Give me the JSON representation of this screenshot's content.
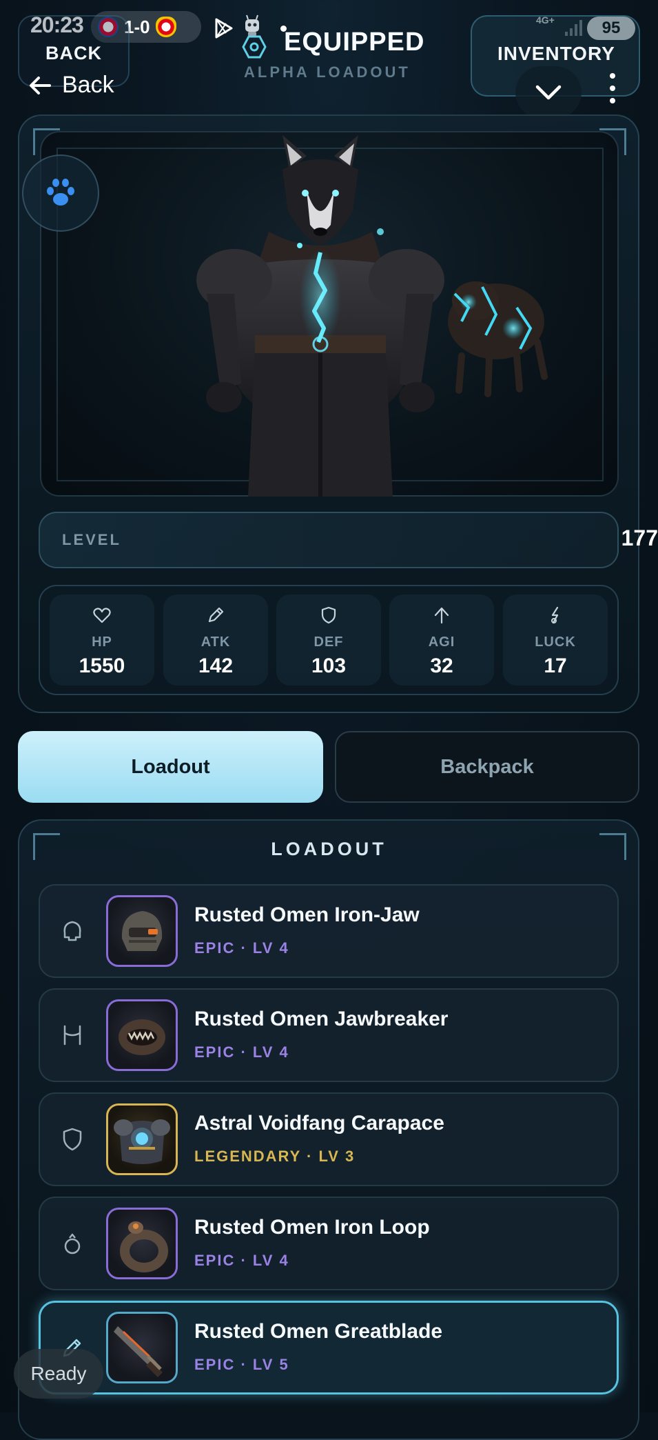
{
  "status_bar": {
    "time": "20:23",
    "score": "1-0",
    "network": "4G+",
    "battery": "95"
  },
  "header": {
    "back_title": "BACK",
    "inventory_title": "INVENTORY",
    "title": "EQUIPPED",
    "subtitle": "ALPHA LOADOUT",
    "back_label": "Back"
  },
  "hero": {
    "level_label": "LEVEL",
    "level_value": "177"
  },
  "stats": [
    {
      "label": "HP",
      "value": "1550",
      "icon": "heart-icon"
    },
    {
      "label": "ATK",
      "value": "142",
      "icon": "pencil-icon"
    },
    {
      "label": "DEF",
      "value": "103",
      "icon": "shield-icon"
    },
    {
      "label": "AGI",
      "value": "32",
      "icon": "arrow-up-icon"
    },
    {
      "label": "LUCK",
      "value": "17",
      "icon": "bolt-icon"
    }
  ],
  "tabs": {
    "loadout": "Loadout",
    "backpack": "Backpack",
    "active": "Loadout"
  },
  "loadout": {
    "title": "LOADOUT",
    "items": [
      {
        "name": "Rusted Omen Iron-Jaw",
        "meta": "EPIC · LV 4",
        "rarity": "epic",
        "slot_icon": "helmet-slot-icon"
      },
      {
        "name": "Rusted Omen Jawbreaker",
        "meta": "EPIC · LV 4",
        "rarity": "epic",
        "slot_icon": "muzzle-slot-icon"
      },
      {
        "name": "Astral Voidfang Carapace",
        "meta": "LEGENDARY · LV 3",
        "rarity": "legendary",
        "slot_icon": "armor-slot-icon"
      },
      {
        "name": "Rusted Omen Iron Loop",
        "meta": "EPIC · LV 4",
        "rarity": "epic",
        "slot_icon": "ring-slot-icon"
      },
      {
        "name": "Rusted Omen Greatblade",
        "meta": "EPIC · LV 5",
        "rarity": "epic",
        "slot_icon": "weapon-slot-icon",
        "selected": true
      }
    ]
  },
  "overlay": {
    "ready": "Ready"
  },
  "colors": {
    "epic": "#9b83e6",
    "legendary": "#d8b652",
    "accent": "#58c3e0",
    "active_tab": "#9adcf2"
  }
}
